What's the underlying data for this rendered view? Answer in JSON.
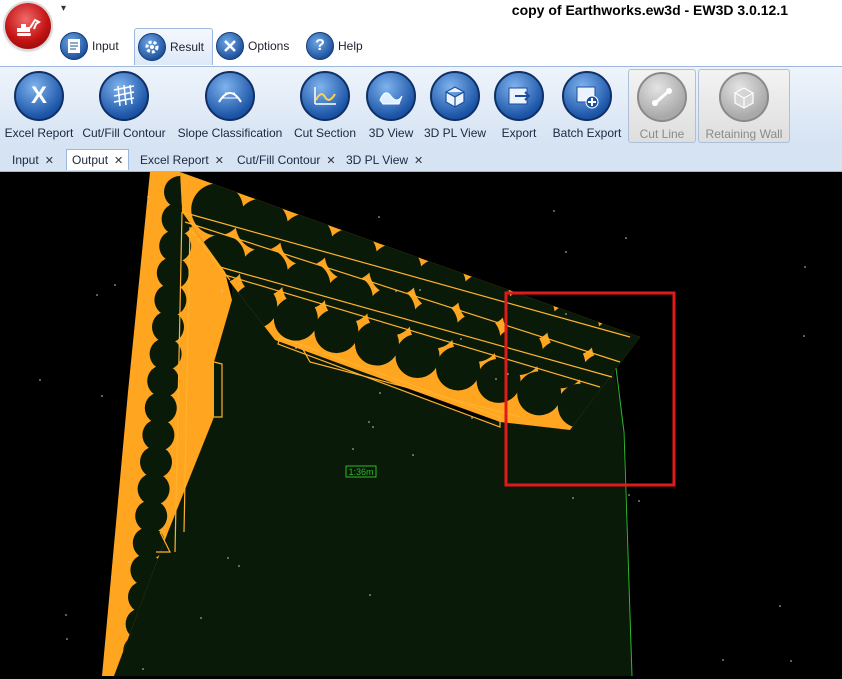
{
  "window": {
    "title": "copy of Earthworks.ew3d - EW3D 3.0.12.1"
  },
  "menu_tabs": [
    {
      "label": "Input"
    },
    {
      "label": "Result"
    },
    {
      "label": "Options"
    },
    {
      "label": "Help"
    }
  ],
  "ribbon": {
    "excel_report": "Excel Report",
    "cut_fill_contour": "Cut/Fill Contour",
    "slope_classification": "Slope Classification",
    "cut_section": "Cut Section",
    "view_3d": "3D View",
    "pl_view_3d": "3D PL View",
    "export": "Export",
    "batch_export": "Batch Export",
    "cut_line": "Cut Line",
    "retaining_wall": "Retaining Wall"
  },
  "doc_tabs": [
    {
      "label": "Input"
    },
    {
      "label": "Output"
    },
    {
      "label": "Excel Report"
    },
    {
      "label": "Cut/Fill Contour"
    },
    {
      "label": "3D PL View"
    }
  ],
  "viewport": {
    "scale_label": "1:36m"
  },
  "colors": {
    "fill": "#ffa51f",
    "ground": "#0a1a08",
    "highlight": "#e01a1a",
    "line": "#2db82d"
  }
}
